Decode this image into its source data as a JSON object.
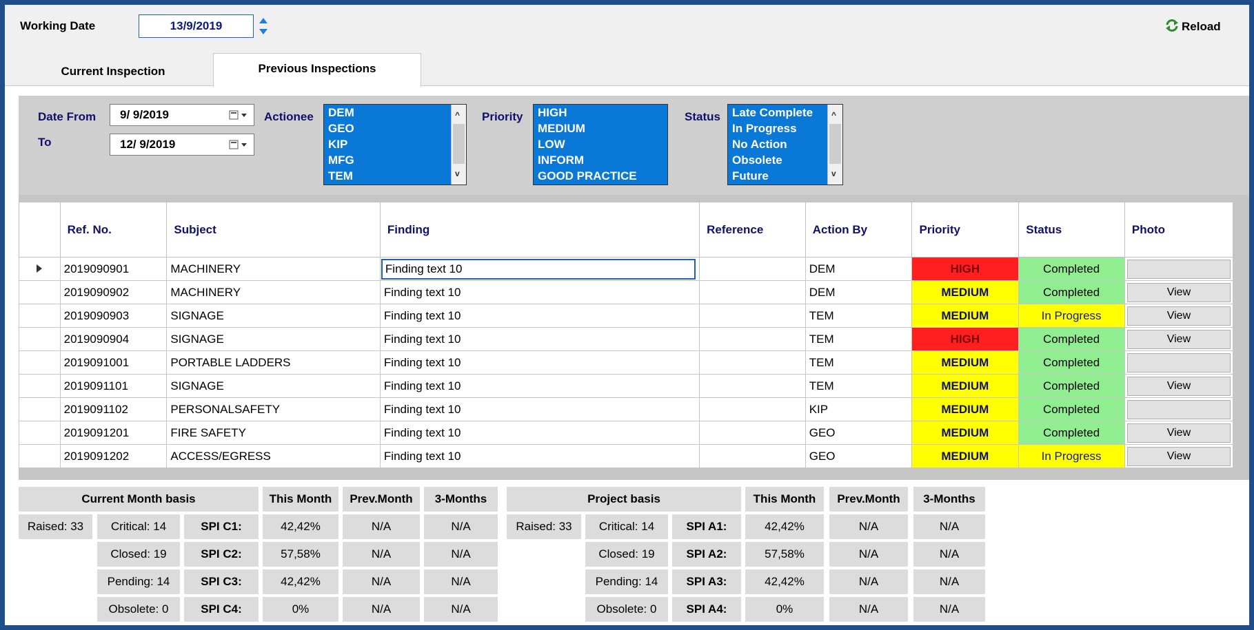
{
  "working_date": {
    "label": "Working Date",
    "value": "13/9/2019"
  },
  "reload_label": "Reload",
  "tabs": {
    "current": "Current Inspection",
    "previous": "Previous Inspections"
  },
  "filters": {
    "date_from_label": "Date From",
    "date_from": "9/ 9/2019",
    "to_label": "To",
    "date_to": "12/ 9/2019",
    "actionee_label": "Actionee",
    "actionee_items": [
      "DEM",
      "GEO",
      "KIP",
      "MFG",
      "TEM"
    ],
    "priority_label": "Priority",
    "priority_items": [
      "HIGH",
      "MEDIUM",
      "LOW",
      "INFORM",
      "GOOD PRACTICE"
    ],
    "status_label": "Status",
    "status_items": [
      "Late Complete",
      "In Progress",
      "No Action",
      "Obsolete",
      "Future"
    ]
  },
  "grid": {
    "columns": [
      "Ref. No.",
      "Subject",
      "Finding",
      "Reference",
      "Action By",
      "Priority",
      "Status",
      "Photo"
    ],
    "rows": [
      {
        "ref": "2019090901",
        "subject": "MACHINERY",
        "finding": "Finding text 10",
        "reference": "",
        "action_by": "DEM",
        "priority": "HIGH",
        "status": "Completed",
        "photo": ""
      },
      {
        "ref": "2019090902",
        "subject": "MACHINERY",
        "finding": "Finding text 10",
        "reference": "",
        "action_by": "DEM",
        "priority": "MEDIUM",
        "status": "Completed",
        "photo": "View"
      },
      {
        "ref": "2019090903",
        "subject": "SIGNAGE",
        "finding": "Finding text 10",
        "reference": "",
        "action_by": "TEM",
        "priority": "MEDIUM",
        "status": "In Progress",
        "photo": "View"
      },
      {
        "ref": "2019090904",
        "subject": "SIGNAGE",
        "finding": "Finding text 10",
        "reference": "",
        "action_by": "TEM",
        "priority": "HIGH",
        "status": "Completed",
        "photo": "View"
      },
      {
        "ref": "2019091001",
        "subject": "PORTABLE LADDERS",
        "finding": "Finding text 10",
        "reference": "",
        "action_by": "TEM",
        "priority": "MEDIUM",
        "status": "Completed",
        "photo": ""
      },
      {
        "ref": "2019091101",
        "subject": "SIGNAGE",
        "finding": "Finding text 10",
        "reference": "",
        "action_by": "TEM",
        "priority": "MEDIUM",
        "status": "Completed",
        "photo": "View"
      },
      {
        "ref": "2019091102",
        "subject": "PERSONALSAFETY",
        "finding": "Finding text 10",
        "reference": "",
        "action_by": "KIP",
        "priority": "MEDIUM",
        "status": "Completed",
        "photo": ""
      },
      {
        "ref": "2019091201",
        "subject": "FIRE SAFETY",
        "finding": "Finding text 10",
        "reference": "",
        "action_by": "GEO",
        "priority": "MEDIUM",
        "status": "Completed",
        "photo": "View"
      },
      {
        "ref": "2019091202",
        "subject": "ACCESS/EGRESS",
        "finding": "Finding text 10",
        "reference": "",
        "action_by": "GEO",
        "priority": "MEDIUM",
        "status": "In Progress",
        "photo": "View"
      }
    ]
  },
  "stats": {
    "current": {
      "title": "Current Month basis",
      "col_this": "This Month",
      "col_prev": "Prev.Month",
      "col_3m": "3-Months",
      "raised": "Raised: 33",
      "rows": [
        {
          "label": "Critical: 14",
          "spi": "SPI C1:",
          "this": "42,42%",
          "prev": "N/A",
          "three": "N/A"
        },
        {
          "label": "Closed: 19",
          "spi": "SPI C2:",
          "this": "57,58%",
          "prev": "N/A",
          "three": "N/A"
        },
        {
          "label": "Pending: 14",
          "spi": "SPI C3:",
          "this": "42,42%",
          "prev": "N/A",
          "three": "N/A"
        },
        {
          "label": "Obsolete: 0",
          "spi": "SPI C4:",
          "this": "0%",
          "prev": "N/A",
          "three": "N/A"
        }
      ]
    },
    "project": {
      "title": "Project basis",
      "col_this": "This Month",
      "col_prev": "Prev.Month",
      "col_3m": "3-Months",
      "raised": "Raised: 33",
      "rows": [
        {
          "label": "Critical: 14",
          "spi": "SPI A1:",
          "this": "42,42%",
          "prev": "N/A",
          "three": "N/A"
        },
        {
          "label": "Closed: 19",
          "spi": "SPI A2:",
          "this": "57,58%",
          "prev": "N/A",
          "three": "N/A"
        },
        {
          "label": "Pending: 14",
          "spi": "SPI A3:",
          "this": "42,42%",
          "prev": "N/A",
          "three": "N/A"
        },
        {
          "label": "Obsolete: 0",
          "spi": "SPI A4:",
          "this": "0%",
          "prev": "N/A",
          "three": "N/A"
        }
      ]
    }
  },
  "colors": {
    "high": "#ff1f1f",
    "medium": "#ffff00",
    "completed": "#90ee90",
    "in_progress": "#ffff00",
    "listbox": "#0a78d7",
    "frame": "#1f4e8a"
  }
}
